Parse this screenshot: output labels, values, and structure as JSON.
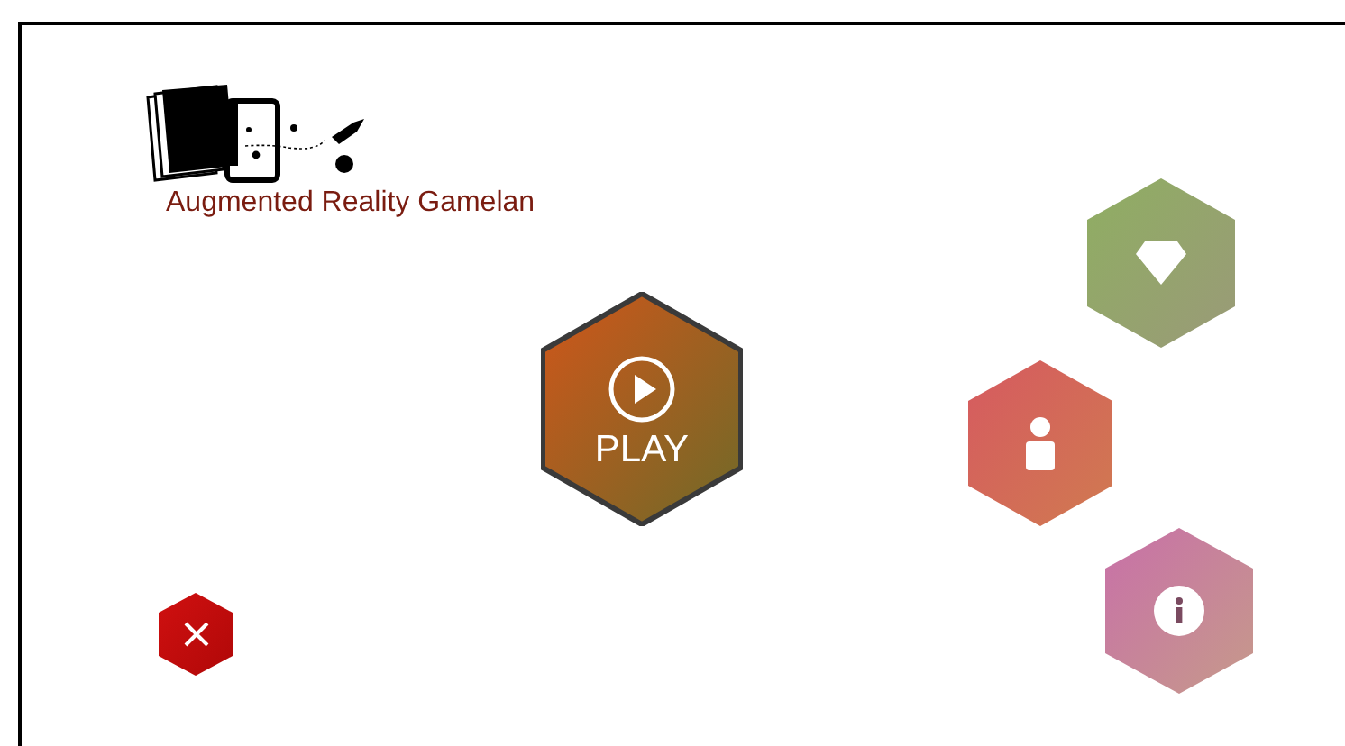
{
  "logo": {
    "title": "Augmented Reality Gamelan"
  },
  "buttons": [
    {
      "kind": "play",
      "label": "PLAY"
    },
    {
      "kind": "diamond"
    },
    {
      "kind": "user"
    },
    {
      "kind": "info"
    },
    {
      "kind": "close"
    }
  ]
}
